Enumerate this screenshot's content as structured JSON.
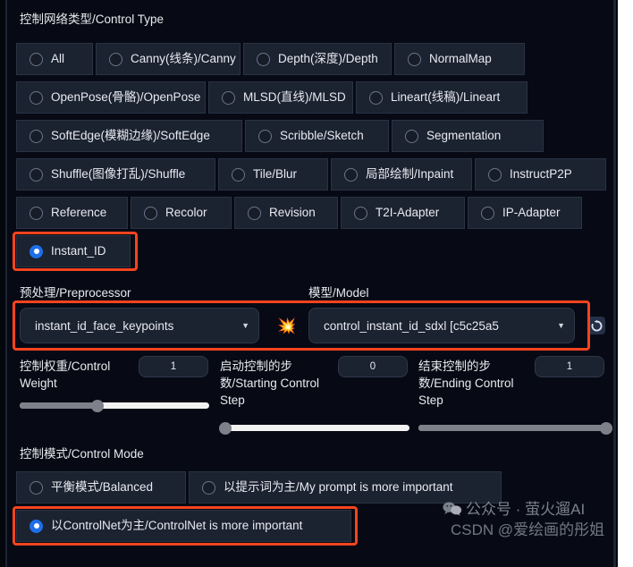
{
  "panel": {
    "control_type_label": "控制网络类型/Control Type",
    "preprocessor_label": "预处理/Preprocessor",
    "model_label": "模型/Model",
    "control_mode_label": "控制模式/Control Mode"
  },
  "control_type": {
    "rows": [
      [
        {
          "label": "All",
          "selected": false
        },
        {
          "label": "Canny(线条)/Canny",
          "selected": false
        },
        {
          "label": "Depth(深度)/Depth",
          "selected": false
        },
        {
          "label": "NormalMap",
          "selected": false
        }
      ],
      [
        {
          "label": "OpenPose(骨骼)/OpenPose",
          "selected": false
        },
        {
          "label": "MLSD(直线)/MLSD",
          "selected": false
        },
        {
          "label": "Lineart(线稿)/Lineart",
          "selected": false
        }
      ],
      [
        {
          "label": "SoftEdge(模糊边缘)/SoftEdge",
          "selected": false
        },
        {
          "label": "Scribble/Sketch",
          "selected": false
        },
        {
          "label": "Segmentation",
          "selected": false
        }
      ],
      [
        {
          "label": "Shuffle(图像打乱)/Shuffle",
          "selected": false
        },
        {
          "label": "Tile/Blur",
          "selected": false
        },
        {
          "label": "局部绘制/Inpaint",
          "selected": false
        },
        {
          "label": "InstructP2P",
          "selected": false
        }
      ],
      [
        {
          "label": "Reference",
          "selected": false
        },
        {
          "label": "Recolor",
          "selected": false
        },
        {
          "label": "Revision",
          "selected": false
        },
        {
          "label": "T2I-Adapter",
          "selected": false
        },
        {
          "label": "IP-Adapter",
          "selected": false
        }
      ],
      [
        {
          "label": "Instant_ID",
          "selected": true
        }
      ]
    ]
  },
  "preprocessor": {
    "value": "instant_id_face_keypoints",
    "caret": "▼"
  },
  "model": {
    "value": "control_instant_id_sdxl [c5c25a5",
    "caret": "▼"
  },
  "icons": {
    "burst": "💥",
    "refresh": "refresh-icon"
  },
  "sliders": [
    {
      "label": "控制权重/Control Weight",
      "value": "1",
      "percent": 41
    },
    {
      "label": "启动控制的步数/Starting Control Step",
      "value": "0",
      "percent": 2
    },
    {
      "label": "结束控制的步数/Ending Control Step",
      "value": "1",
      "percent": 99
    }
  ],
  "control_mode": {
    "rows": [
      [
        {
          "label": "平衡模式/Balanced",
          "selected": false
        },
        {
          "label": "以提示词为主/My prompt is more important",
          "selected": false
        }
      ],
      [
        {
          "label": "以ControlNet为主/ControlNet is more important",
          "selected": true
        }
      ]
    ]
  },
  "watermark": {
    "line1": "公众号 · 萤火遛AI",
    "line2": "CSDN @爱绘画的彤姐"
  },
  "colors": {
    "accent_blue": "#1e6fe8",
    "highlight_red": "#f4441e",
    "panel_bg": "#070a14",
    "chip_bg": "#1b2230"
  }
}
